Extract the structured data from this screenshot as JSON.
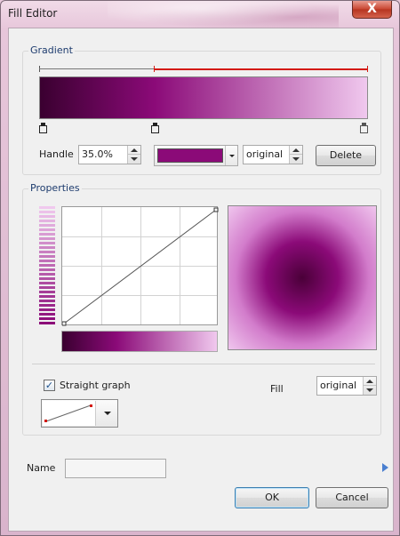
{
  "window": {
    "title": "Fill Editor",
    "close_glyph": "X"
  },
  "gradient": {
    "group_label": "Gradient",
    "stops": [
      {
        "position": 0,
        "color": "#3a0030"
      },
      {
        "position": 0.35,
        "color": "#8b0a78"
      },
      {
        "position": 1.0,
        "color": "#f0c8ee"
      }
    ],
    "handle_label": "Handle",
    "handle_value": "35.0%",
    "handle_color": "#8b0a78",
    "opacity_value": "original",
    "delete_label": "Delete"
  },
  "properties": {
    "group_label": "Properties",
    "straight_graph_label": "Straight graph",
    "straight_graph_checked": true,
    "checkmark_glyph": "✓",
    "fill_label": "Fill",
    "fill_value": "original",
    "preview_center_color": "#4a0038",
    "preview_edge_color": "#f0c6ee"
  },
  "footer": {
    "name_label": "Name",
    "name_value": "",
    "ok_label": "OK",
    "cancel_label": "Cancel"
  },
  "icons": [
    "close-icon",
    "spin-up-icon",
    "spin-down-icon",
    "dropdown-caret-icon",
    "play-arrow-icon",
    "checkmark-icon",
    "curve-preview-icon"
  ]
}
